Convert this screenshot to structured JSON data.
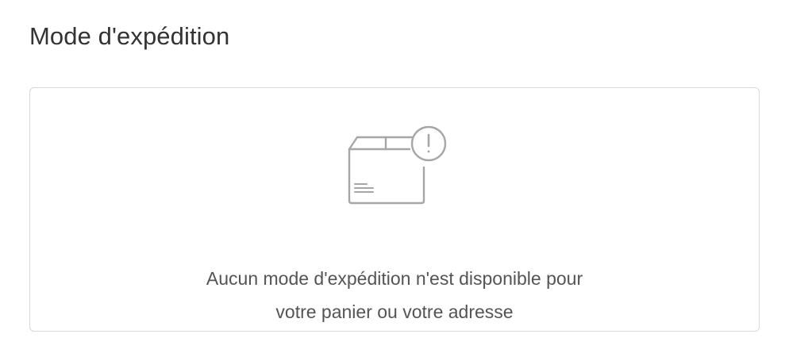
{
  "shipping": {
    "title": "Mode d'expédition",
    "empty_state": {
      "icon": "package-warning-icon",
      "message_line1": "Aucun mode d'expédition n'est disponible pour",
      "message_line2": "votre panier ou votre adresse"
    }
  },
  "colors": {
    "title_text": "#333333",
    "body_text": "#545454",
    "border": "#d9d9d9",
    "icon_stroke": "#a6a6a6",
    "background": "#ffffff"
  }
}
